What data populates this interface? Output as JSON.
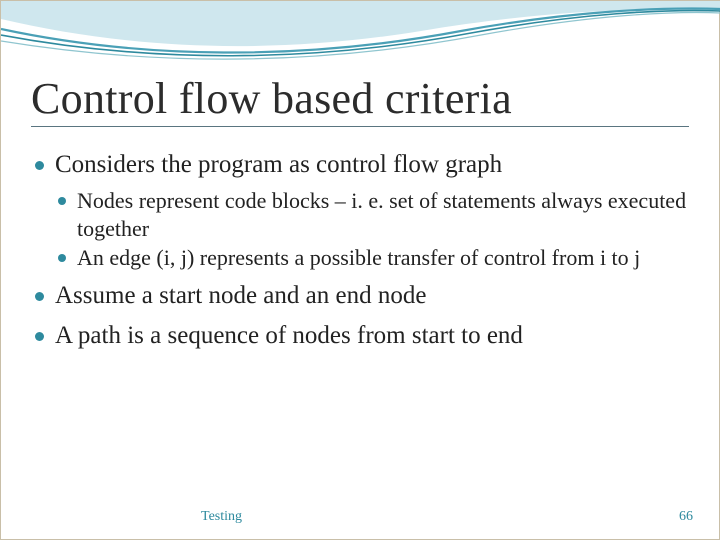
{
  "title": "Control flow based criteria",
  "bullets": {
    "b1": "Considers the  program as control flow graph",
    "b1a": "Nodes represent code blocks – i. e. set of statements always executed together",
    "b1b": "An edge (i, j) represents a possible transfer of control from i to j",
    "b2": "Assume a start node and an end node",
    "b3": "A path is a sequence of nodes from start to end"
  },
  "footer": {
    "label": "Testing",
    "page": "66"
  },
  "theme": {
    "accent": "#2e8a9e",
    "rule": "#5a7580"
  }
}
